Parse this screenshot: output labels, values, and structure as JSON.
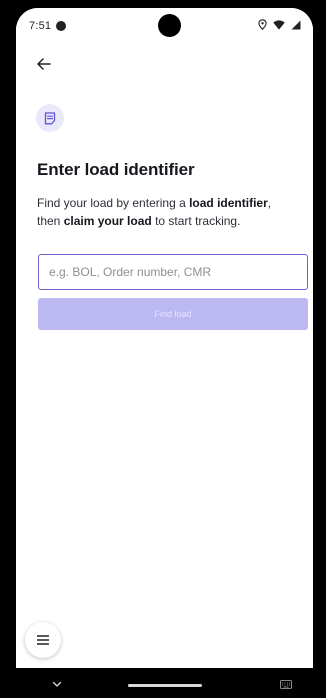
{
  "status_bar": {
    "time": "7:51"
  },
  "header": {
    "back_icon": "arrow-left-icon",
    "doc_icon": "document-note-icon"
  },
  "main": {
    "title": "Enter load identifier",
    "description": {
      "part1": "Find your load by entering a ",
      "bold1": "load identifier",
      "part2": ", then ",
      "bold2": "claim your load",
      "part3": " to start tracking."
    },
    "search": {
      "placeholder": "e.g. BOL, Order number, CMR",
      "value": ""
    },
    "find_button_label": "Find load"
  },
  "fab": {
    "icon": "menu-icon"
  },
  "colors": {
    "accent": "#6b62d6",
    "button_disabled": "#bcb8f1",
    "icon_bg": "#eae8fb"
  }
}
